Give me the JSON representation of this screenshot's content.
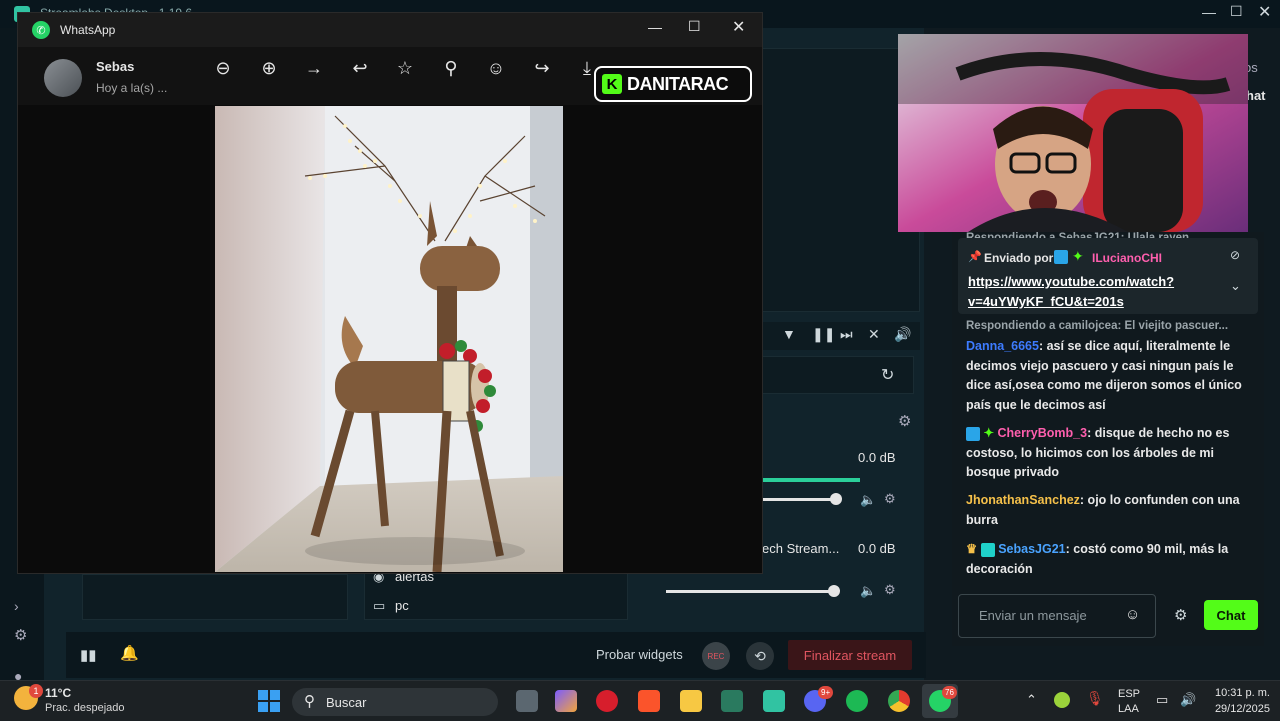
{
  "streamlabs": {
    "title": "Streamlabs Desktop - 1.19.6",
    "right_fragment_1": "os",
    "right_fragment_2": "hat",
    "sources": [
      "alertas",
      "pc"
    ],
    "mixer": [
      {
        "label": "",
        "db": "0.0 dB"
      },
      {
        "label": "ech Stream...",
        "db": "0.0 dB"
      }
    ],
    "bottom": {
      "test_widgets": "Probar widgets",
      "rec": "REC",
      "finish": "Finalizar stream"
    }
  },
  "whatsapp": {
    "app_name": "WhatsApp",
    "contact_name": "Sebas",
    "contact_time": "Hoy a la(s) ...",
    "toolbar": [
      "zoom-out-icon",
      "zoom-in-icon",
      "forward-arrow-icon",
      "reply-icon",
      "star-icon",
      "pin-icon",
      "emoji-icon",
      "share-icon",
      "download-icon"
    ]
  },
  "overlay": {
    "kick_letter": "K",
    "channel": "DANITARAC"
  },
  "chat": {
    "top_reply": "Respondiendo a SebasJG21: Ulala rayen",
    "pinned": {
      "label": "Enviado por",
      "user": "ILucianoCHI",
      "link": "https://www.youtube.com/watch?v=4uYWyKF_fCU&t=201s",
      "link_line1": "https://www.youtube.com/watch?",
      "link_line2": "v=4uYWyKF_fCU&t=201s"
    },
    "reply2": "Respondiendo a camilojcea: El viejito pascuer...",
    "messages": [
      {
        "user": "Danna_6665",
        "color": "#3d7bff",
        "text": ": así se dice aquí, literalmente le decimos viejo pascuero y casi ningun país le dice así,osea como me dijeron somos el único país que le decimos así"
      },
      {
        "user": "CherryBomb_3",
        "color": "#ff5fae",
        "text": ": disque de hecho no es costoso, lo hicimos con los árboles de mi bosque privado"
      },
      {
        "user": "JhonathanSanchez",
        "color": "#f5c04a",
        "text": ": ojo lo confunden con una burra"
      },
      {
        "user": "SebasJG21",
        "color": "#4aa3ff",
        "text": ": costó como 90 mil, más la decoración"
      }
    ],
    "input_placeholder": "Enviar un mensaje",
    "send_label": "Chat"
  },
  "taskbar": {
    "weather_temp": "11°C",
    "weather_desc": "Prac. despejado",
    "weather_badge": "1",
    "search_placeholder": "Buscar",
    "badges": {
      "discord": "9+",
      "whatsapp": "76"
    },
    "lang_1": "ESP",
    "lang_2": "LAA",
    "time": "10:31 p. m.",
    "date": "29/12/2025"
  },
  "colors": {
    "kick_green": "#53fc18",
    "finish_red": "#e05560",
    "whatsapp_green": "#25d366"
  }
}
